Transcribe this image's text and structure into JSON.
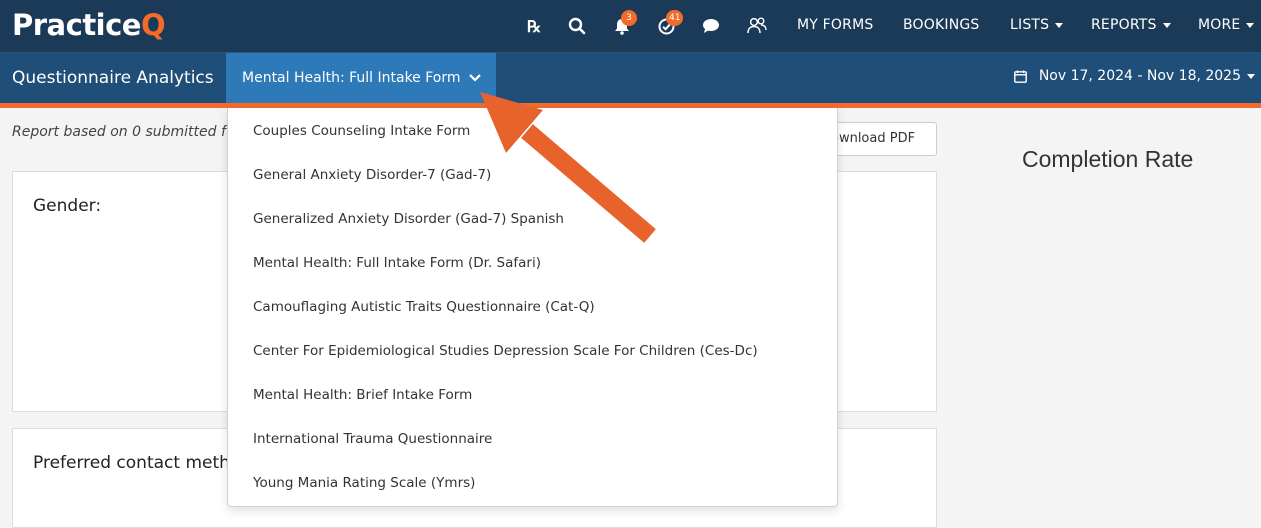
{
  "brand": {
    "name_main": "Practice",
    "name_accent": "Q",
    "accent_color": "#f26b2a",
    "bar_color": "#1b3a57"
  },
  "topnav": {
    "icons": [
      {
        "name": "rx-icon"
      },
      {
        "name": "search-icon"
      },
      {
        "name": "bell-icon",
        "badge": "3"
      },
      {
        "name": "check-circle-icon",
        "badge": "41"
      },
      {
        "name": "chat-icon"
      },
      {
        "name": "people-icon"
      }
    ],
    "links": {
      "my_forms": "MY FORMS",
      "bookings": "BOOKINGS",
      "lists": "LISTS",
      "reports": "REPORTS",
      "more": "MORE"
    }
  },
  "subbar": {
    "title": "Questionnaire Analytics",
    "selected_form": "Mental Health: Full Intake Form",
    "date_range": "Nov 17, 2024 - Nov 18, 2025"
  },
  "main": {
    "report_note": "Report based on 0 submitted f",
    "download_label": "ownload PDF",
    "completion_title": "Completion Rate",
    "cards": [
      {
        "title": "Gender:"
      },
      {
        "title": "Preferred contact meth"
      }
    ]
  },
  "dropdown": {
    "items": [
      "Couples Counseling Intake Form",
      "General Anxiety Disorder-7 (Gad-7)",
      "Generalized Anxiety Disorder (Gad-7) Spanish",
      "Mental Health: Full Intake Form (Dr. Safari)",
      "Camouflaging Autistic Traits Questionnaire (Cat-Q)",
      "Center For Epidemiological Studies Depression Scale For Children (Ces-Dc)",
      "Mental Health: Brief Intake Form",
      "International Trauma Questionnaire",
      "Young Mania Rating Scale (Ymrs)"
    ]
  },
  "annotation": {
    "arrow_color": "#e8622c"
  }
}
